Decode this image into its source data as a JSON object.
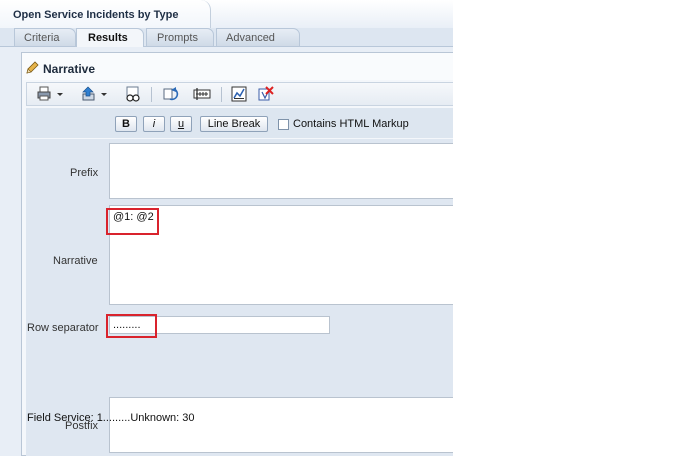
{
  "header": {
    "title": "Open Service Incidents by Type"
  },
  "tabs": [
    {
      "label": "Criteria"
    },
    {
      "label": "Results"
    },
    {
      "label": "Prompts"
    },
    {
      "label": "Advanced"
    }
  ],
  "panel": {
    "title": "Narrative"
  },
  "toolbar": {
    "icons": [
      "print-icon",
      "export-icon",
      "preview-icon",
      "refresh-icon",
      "properties-icon",
      "chart-icon",
      "delete-icon"
    ]
  },
  "format": {
    "bold": "B",
    "italic": "i",
    "underline": "u",
    "line_break": "Line Break",
    "html_markup_label": "Contains HTML Markup",
    "html_markup_checked": false
  },
  "fields": {
    "prefix_label": "Prefix",
    "prefix_value": "",
    "narrative_label": "Narrative",
    "narrative_value": "@1: @2",
    "row_separator_label": "Row separator",
    "row_separator_value": ".........",
    "postfix_label": "Postfix",
    "postfix_value": ""
  },
  "preview": {
    "text": "Field Service: 1.........Unknown: 30"
  }
}
